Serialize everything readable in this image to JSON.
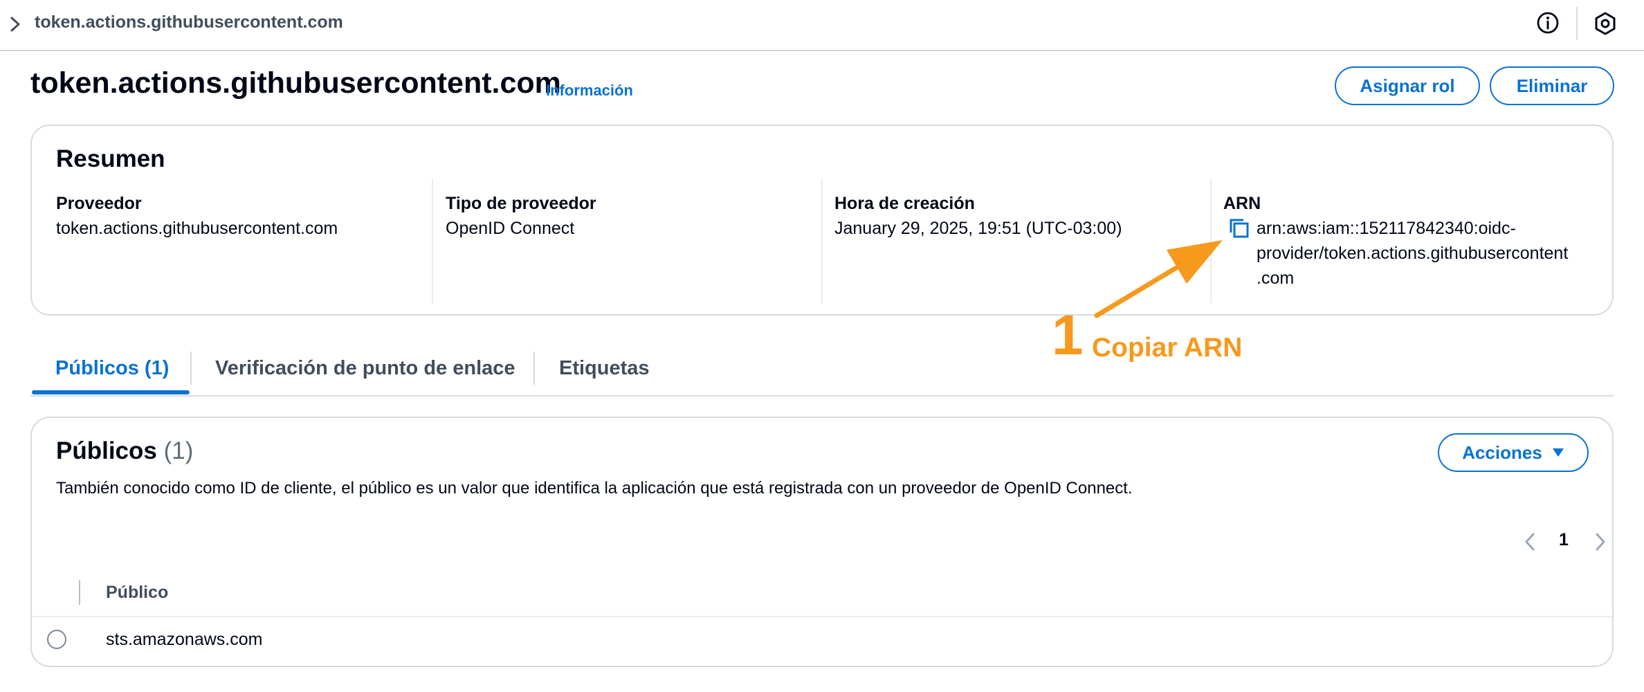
{
  "breadcrumb": {
    "current": "token.actions.githubusercontent.com"
  },
  "header": {
    "title": "token.actions.githubusercontent.com",
    "info_link": "Información",
    "assign_role": "Asignar rol",
    "delete": "Eliminar"
  },
  "summary": {
    "title": "Resumen",
    "provider_label": "Proveedor",
    "provider_value": "token.actions.githubusercontent.com",
    "provider_type_label": "Tipo de proveedor",
    "provider_type_value": "OpenID Connect",
    "created_label": "Hora de creación",
    "created_value": "January 29, 2025, 19:51 (UTC-03:00)",
    "arn_label": "ARN",
    "arn_lines": [
      "arn:aws:iam::152117842340:oidc-",
      "provider/token.actions.githubusercontent",
      ".com"
    ]
  },
  "tabs": [
    {
      "label": "Públicos (1)",
      "active": true
    },
    {
      "label": "Verificación de punto de enlace",
      "active": false
    },
    {
      "label": "Etiquetas",
      "active": false
    }
  ],
  "audiences": {
    "title": "Públicos",
    "count": "(1)",
    "description": "También conocido como ID de cliente, el público es un valor que identifica la aplicación que está registrada con un proveedor de OpenID Connect.",
    "actions_label": "Acciones",
    "page": "1",
    "column_header": "Público",
    "rows": [
      "sts.amazonaws.com"
    ]
  },
  "annotation": {
    "step": "1",
    "label": "Copiar ARN",
    "color": "#f7991c"
  },
  "colors": {
    "accent": "#0972d3",
    "text": "#000716",
    "border": "#d5dbdb"
  }
}
